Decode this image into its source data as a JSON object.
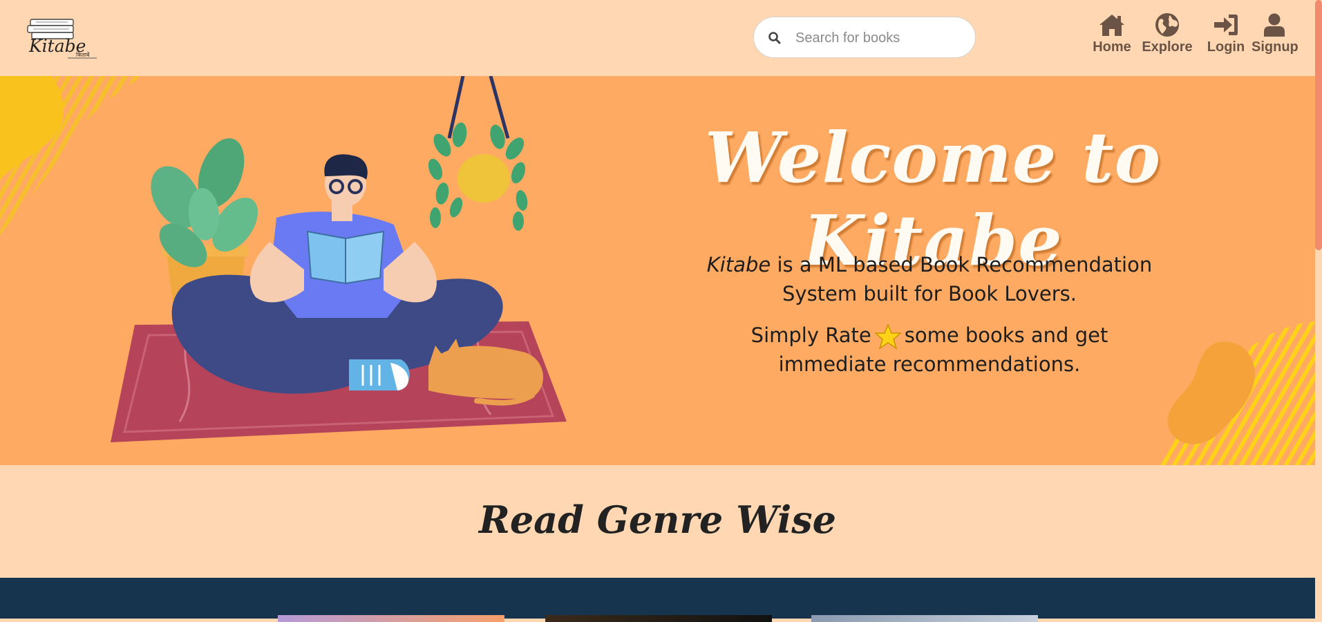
{
  "logo": {
    "text": "Kitabe",
    "sub": "किताबें"
  },
  "search": {
    "placeholder": "Search for books",
    "value": ""
  },
  "nav": [
    {
      "label": "Home",
      "icon": "home-icon"
    },
    {
      "label": "Explore",
      "icon": "globe-icon"
    },
    {
      "label": "Login",
      "icon": "sign-in-icon"
    },
    {
      "label": "Signup",
      "icon": "user-icon"
    }
  ],
  "hero": {
    "title": "Welcome to Kitabe",
    "line1_em": "Kitabe",
    "line1_rest": " is a ML based Book Recommendation",
    "line2": "System built for Book Lovers.",
    "line3_a": "Simply Rate",
    "line3_b": "some books and get",
    "line4": "immediate recommendations."
  },
  "genre": {
    "title": "Read Genre Wise"
  },
  "colors": {
    "navbar_bg": "#ffd8b3",
    "hero_bg": "#ffaa62",
    "nav_text": "#6b5445",
    "genre_band": "#17344f",
    "scroll_thumb": "#f28a6e"
  }
}
